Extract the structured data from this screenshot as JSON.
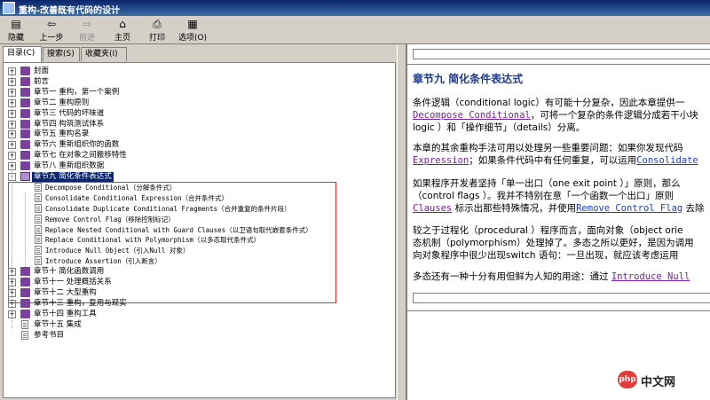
{
  "window": {
    "title": "重构-改善既有代码的设计"
  },
  "toolbar": {
    "buttons": [
      {
        "label": "隐藏",
        "icon": "hide-icon"
      },
      {
        "label": "上一步",
        "icon": "back-arrow-icon"
      },
      {
        "label": "前进",
        "icon": "forward-arrow-icon",
        "disabled": true
      },
      {
        "label": "主页",
        "icon": "home-icon"
      },
      {
        "label": "打印",
        "icon": "print-icon"
      },
      {
        "label": "选项(O)",
        "icon": "options-icon"
      }
    ]
  },
  "tabs": [
    {
      "label": "目录(C)",
      "active": true
    },
    {
      "label": "搜索(S)"
    },
    {
      "label": "收藏夹(I)"
    }
  ],
  "tree": [
    {
      "label": "封面",
      "expander": "+",
      "icon": "book-closed-icon"
    },
    {
      "label": "前言",
      "expander": "+",
      "icon": "book-closed-icon"
    },
    {
      "label": "章节一 重构，第一个案例",
      "expander": "+",
      "icon": "book-closed-icon"
    },
    {
      "label": "章节二 重构原则",
      "expander": "+",
      "icon": "book-closed-icon"
    },
    {
      "label": "章节三 代码的坏味道",
      "expander": "+",
      "icon": "book-closed-icon"
    },
    {
      "label": "章节四 构筑测试体系",
      "expander": "+",
      "icon": "book-closed-icon"
    },
    {
      "label": "章节五 重构名录",
      "expander": "+",
      "icon": "book-closed-icon"
    },
    {
      "label": "章节六 重新组织你的函数",
      "expander": "+",
      "icon": "book-closed-icon"
    },
    {
      "label": "章节七 在对象之间搬移特性",
      "expander": "+",
      "icon": "book-closed-icon"
    },
    {
      "label": "章节八 重新组织数据",
      "expander": "+",
      "icon": "book-closed-icon"
    },
    {
      "label": "章节九 简化条件表达式",
      "expander": "-",
      "icon": "book-open-icon",
      "selected": true
    },
    {
      "label": "Decompose Conditional（分解条件式）",
      "child": true
    },
    {
      "label": "Consolidate Conditional Expression（合并条件式）",
      "child": true
    },
    {
      "label": "Consolidate Duplicate Conditional Fragments（合并重复的条件片段）",
      "child": true
    },
    {
      "label": "Remove Control Flag（移除控制标记）",
      "child": true
    },
    {
      "label": "Replace Nested Conditional with Guard Clauses（以卫语句取代嵌套条件式）",
      "child": true
    },
    {
      "label": "Replace Conditional with Polymorphism（以多态取代条件式）",
      "child": true
    },
    {
      "label": "Introduce Null Object（引入Null 对象）",
      "child": true
    },
    {
      "label": "Introduce Assertion（引入断言）",
      "child": true
    },
    {
      "label": "章节十 简化函数调用",
      "expander": "+",
      "icon": "book-closed-icon"
    },
    {
      "label": "章节十一 处理概括关系",
      "expander": "+",
      "icon": "book-closed-icon"
    },
    {
      "label": "章节十二 大型重构",
      "expander": "+",
      "icon": "book-closed-icon"
    },
    {
      "label": "章节十三 重构，复用与现实",
      "expander": "+",
      "icon": "book-closed-icon"
    },
    {
      "label": "章节十四 重构工具",
      "expander": "+",
      "icon": "book-closed-icon"
    },
    {
      "label": "章节十五 集成",
      "icon": "page-icon"
    },
    {
      "label": "参考书目",
      "icon": "page-icon"
    }
  ],
  "content": {
    "title": "章节九 简化条件表达式",
    "p1": {
      "line1": "条件逻辑（conditional logic）有可能十分复杂，因此本章提供一",
      "line2_link": "Decompose Conditional",
      "line2_rest": "，可将一个复杂的条件逻辑分成若干小块",
      "line3": "logic ）和「操作细节」（details）分离。"
    },
    "p2": {
      "line1": "本章的其余重构手法可用以处理另一些重要问题：如果你发现代码",
      "line2_link": "Expression",
      "line2_mid": "；如果条件代码中有任何重复，可以运用",
      "line2_link2": "Consolidate"
    },
    "p3": {
      "line1": "如果程序开发者坚持「单一出口（one exit point ）」原则，那么",
      "line2": "（control flags ）。我并不特别在意「一个函数一个出口」原则",
      "line3_link": "Clauses",
      "line3_mid": " 标示出那些特殊情况，并使用",
      "line3_link2": "Remove Control Flag",
      "line3_rest": " 去除"
    },
    "p4": {
      "line1": "较之于过程化（procedural ）程序而言，面向对象（object orie",
      "line2": "态机制（polymorphism）处理掉了。多态之所以更好，是因为调用",
      "line3": "向对象程序中很少出现switch 语句：一旦出现，就应该考虑运用"
    },
    "p5": {
      "line1": "多态还有一种十分有用但鲜为人知的用途：通过 ",
      "line1_link": "Introduce Null"
    }
  },
  "watermark": {
    "logo": "php",
    "text": "中文网"
  }
}
